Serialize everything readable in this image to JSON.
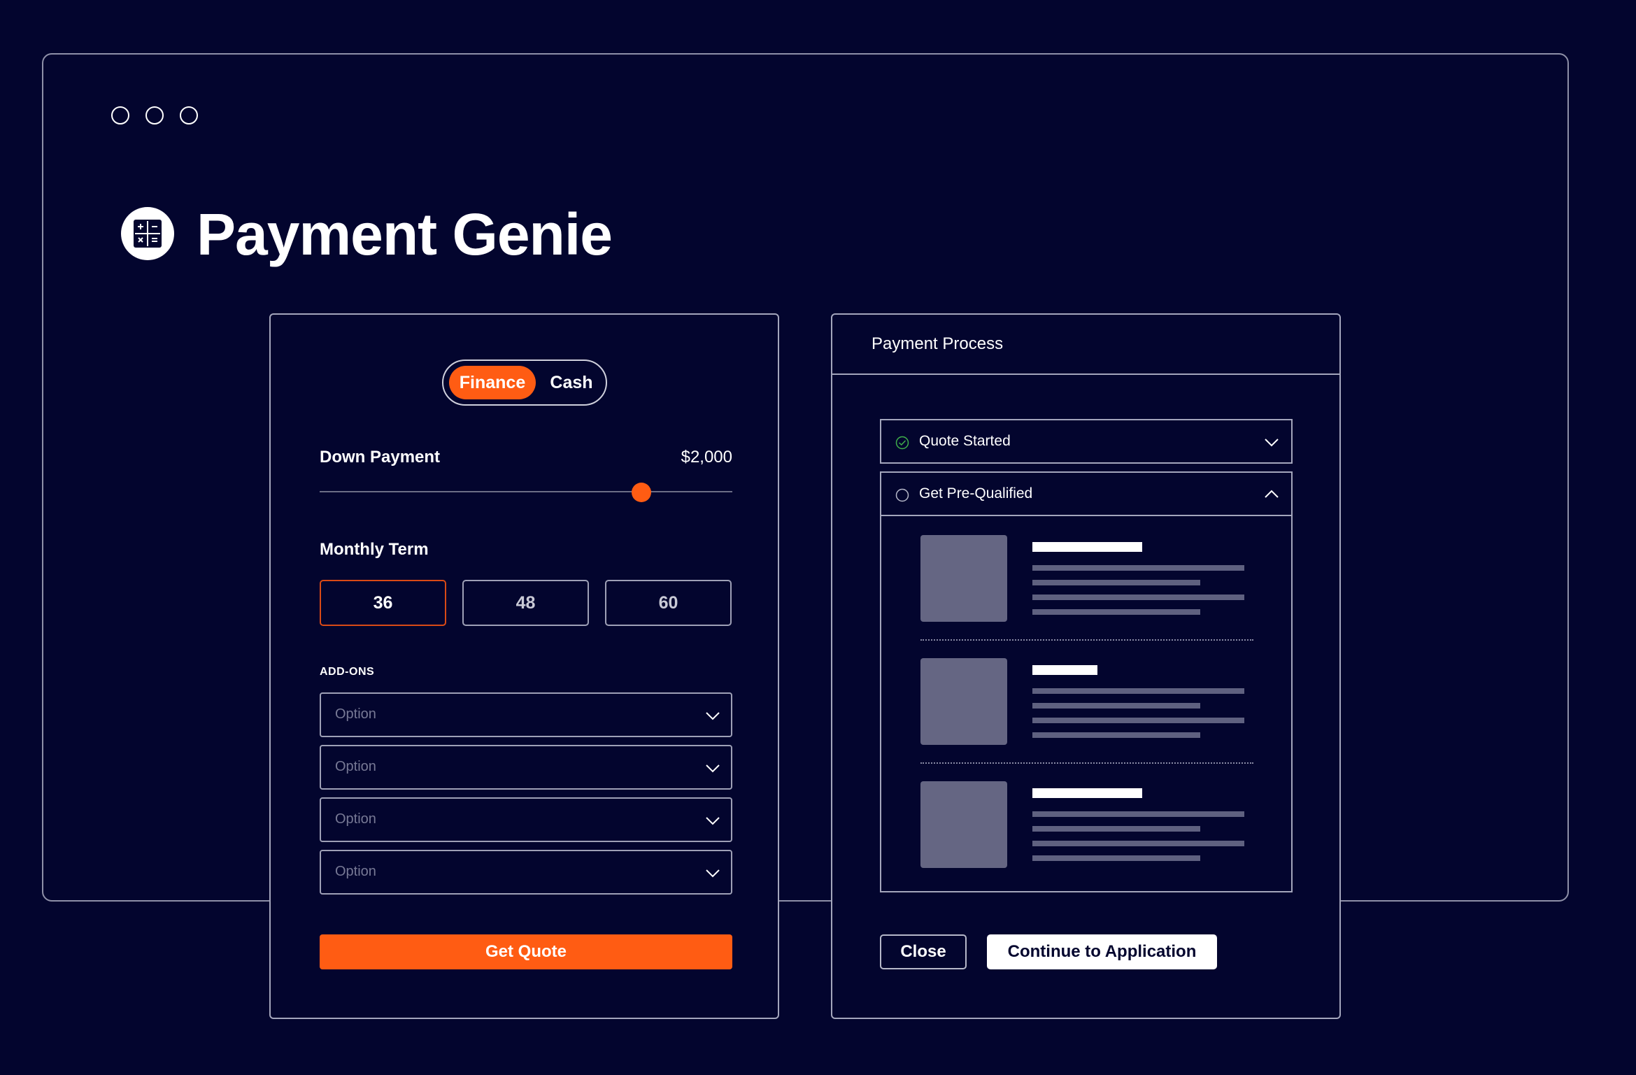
{
  "colors": {
    "background": "#03052E",
    "accent": "#FF5C13",
    "check": "#3FAE4A"
  },
  "window": {
    "controls": [
      "circle",
      "circle",
      "circle"
    ]
  },
  "app": {
    "title": "Payment Genie",
    "logo_icon": "calculator-icon"
  },
  "quote_form": {
    "toggle": {
      "active": "Finance",
      "inactive": "Cash"
    },
    "down_payment": {
      "label": "Down Payment",
      "value": "$2,000",
      "slider_fraction": 0.78
    },
    "monthly_term": {
      "label": "Monthly Term",
      "options": [
        "36",
        "48",
        "60"
      ],
      "selected": "36"
    },
    "addons": {
      "label": "ADD-ONS",
      "selects": [
        {
          "placeholder": "Option"
        },
        {
          "placeholder": "Option"
        },
        {
          "placeholder": "Option"
        },
        {
          "placeholder": "Option"
        }
      ]
    },
    "submit_label": "Get Quote"
  },
  "payment_process": {
    "title": "Payment Process",
    "steps": [
      {
        "label": "Quote Started",
        "status": "complete",
        "expanded": false
      },
      {
        "label": "Get Pre-Qualified",
        "status": "pending",
        "expanded": true
      }
    ],
    "close_label": "Close",
    "continue_label": "Continue to Application"
  }
}
